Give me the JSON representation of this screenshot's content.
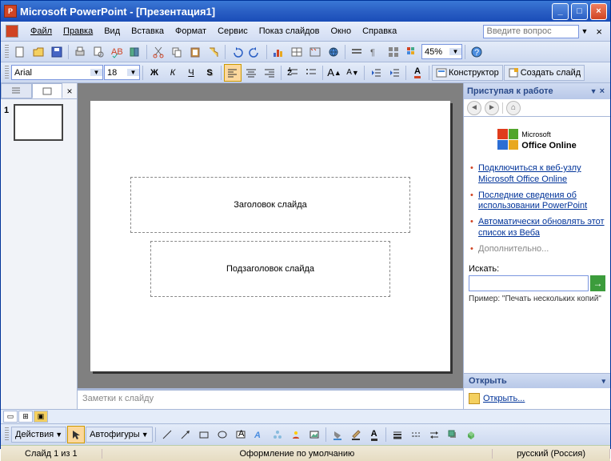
{
  "title": "Microsoft PowerPoint - [Презентация1]",
  "askPlaceholder": "Введите вопрос",
  "menu": [
    "Файл",
    "Правка",
    "Вид",
    "Вставка",
    "Формат",
    "Сервис",
    "Показ слайдов",
    "Окно",
    "Справка"
  ],
  "zoom": "45%",
  "font": "Arial",
  "fontSize": "18",
  "designer": "Конструктор",
  "newSlide": "Создать слайд",
  "slideNum": "1",
  "slideTitlePH": "Заголовок слайда",
  "slideSubPH": "Подзаголовок слайда",
  "notesPH": "Заметки к слайду",
  "taskpane": {
    "title": "Приступая к работе",
    "officeBrand1": "Microsoft",
    "officeBrand2": "Office Online",
    "links": [
      "Подключиться к веб-узлу Microsoft Office Online",
      "Последние сведения об использовании PowerPoint",
      "Автоматически обновлять этот список из Веба"
    ],
    "moreLabel": "Дополнительно...",
    "searchLabel": "Искать:",
    "example": "Пример: \"Печать нескольких копий\"",
    "openHeader": "Открыть",
    "openLink": "Открыть..."
  },
  "actions": "Действия",
  "autoshapes": "Автофигуры",
  "status": {
    "slide": "Слайд 1 из 1",
    "design": "Оформление по умолчанию",
    "lang": "русский (Россия)"
  }
}
